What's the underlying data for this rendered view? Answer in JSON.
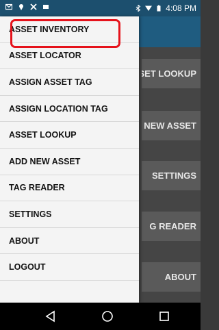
{
  "status_bar": {
    "time": "4:08 PM",
    "icons": [
      "mail-icon",
      "location-icon",
      "signal-off-icon",
      "bluetooth-icon",
      "wifi-icon",
      "battery-icon"
    ]
  },
  "background_buttons": [
    {
      "label": "SET LOOKUP"
    },
    {
      "label": "NEW ASSET"
    },
    {
      "label": "SETTINGS"
    },
    {
      "label": "G READER"
    },
    {
      "label": "ABOUT"
    }
  ],
  "drawer": {
    "items": [
      {
        "label": "ASSET INVENTORY"
      },
      {
        "label": "ASSET LOCATOR"
      },
      {
        "label": "ASSIGN ASSET TAG"
      },
      {
        "label": "ASSIGN LOCATION TAG"
      },
      {
        "label": "ASSET LOOKUP"
      },
      {
        "label": "ADD NEW ASSET"
      },
      {
        "label": "TAG READER"
      },
      {
        "label": "SETTINGS"
      },
      {
        "label": "ABOUT"
      },
      {
        "label": "LOGOUT"
      }
    ],
    "highlighted_item": "ASSET INVENTORY",
    "highlight_color": "#e5121b"
  },
  "nav_bar": {
    "buttons": [
      "back-icon",
      "home-icon",
      "recents-icon"
    ]
  },
  "colors": {
    "status_bar": "#1c4f6e",
    "app_header": "#1f5c80",
    "drawer_bg": "#f4f4f4"
  }
}
